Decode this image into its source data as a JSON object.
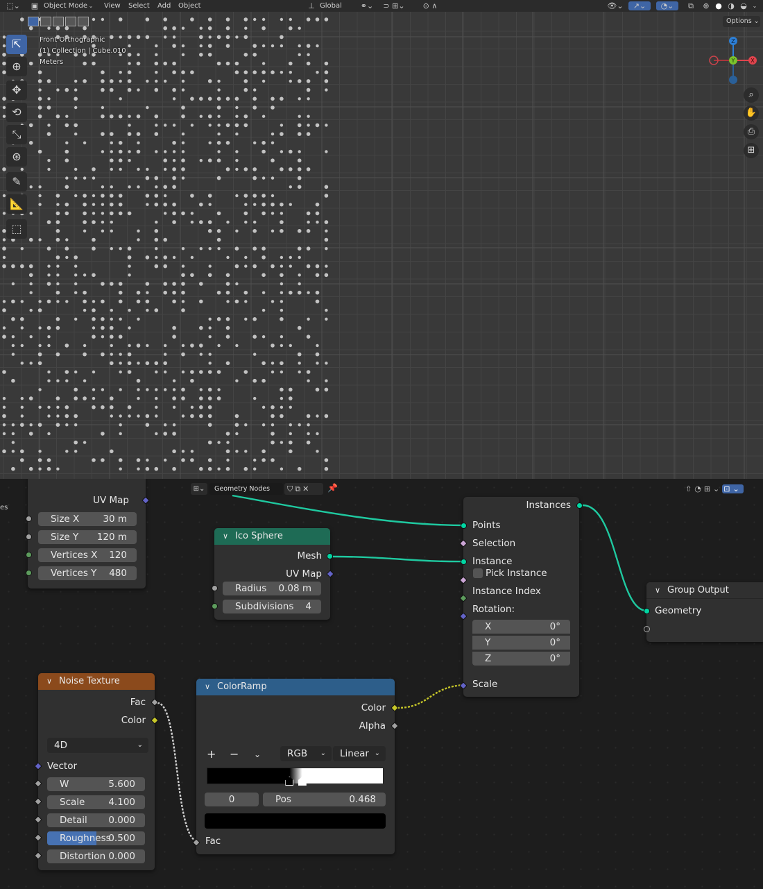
{
  "viewport_header": {
    "mode": "Object Mode",
    "menu": [
      "View",
      "Select",
      "Add",
      "Object"
    ],
    "orientation": "Global",
    "options_label": "Options"
  },
  "viewport_overlay": {
    "view_name": "Front Orthographic",
    "collection": "(1) Collection | Cube.010",
    "units": "Meters"
  },
  "gizmo": {
    "z": "Z",
    "y": "Y",
    "x": "X"
  },
  "node_editor": {
    "tree_name": "Geometry Nodes",
    "left_cut_text": "es"
  },
  "grid_node": {
    "output_uvmap": "UV Map",
    "fields": [
      {
        "label": "Size X",
        "value": "30 m"
      },
      {
        "label": "Size Y",
        "value": "120 m"
      },
      {
        "label": "Vertices X",
        "value": "120"
      },
      {
        "label": "Vertices Y",
        "value": "480"
      }
    ]
  },
  "ico_sphere": {
    "title": "Ico Sphere",
    "out_mesh": "Mesh",
    "out_uvmap": "UV Map",
    "radius_label": "Radius",
    "radius_value": "0.08 m",
    "subdiv_label": "Subdivisions",
    "subdiv_value": "4"
  },
  "instance_node": {
    "out_instances": "Instances",
    "in_points": "Points",
    "in_selection": "Selection",
    "in_instance": "Instance",
    "pick_instance": "Pick Instance",
    "instance_index": "Instance Index",
    "rotation": "Rotation:",
    "rot": [
      {
        "label": "X",
        "value": "0°"
      },
      {
        "label": "Y",
        "value": "0°"
      },
      {
        "label": "Z",
        "value": "0°"
      }
    ],
    "scale": "Scale"
  },
  "group_output": {
    "title": "Group Output",
    "geometry": "Geometry"
  },
  "noise_texture": {
    "title": "Noise Texture",
    "out_fac": "Fac",
    "out_color": "Color",
    "dimension": "4D",
    "in_vector": "Vector",
    "fields": [
      {
        "label": "W",
        "value": "5.600"
      },
      {
        "label": "Scale",
        "value": "4.100"
      },
      {
        "label": "Detail",
        "value": "0.000"
      },
      {
        "label": "Roughness",
        "value": "0.500",
        "fill": 0.5
      },
      {
        "label": "Distortion",
        "value": "0.000"
      }
    ]
  },
  "color_ramp": {
    "title": "ColorRamp",
    "out_color": "Color",
    "out_alpha": "Alpha",
    "mode": "RGB",
    "interpolation": "Linear",
    "add": "+",
    "remove": "−",
    "stop_index": "0",
    "pos_label": "Pos",
    "pos_value": "0.468",
    "in_fac": "Fac",
    "stops": [
      0.468,
      0.54
    ]
  },
  "colors": {
    "geometry_link": "#1fc9a0",
    "noise_header": "#8b4a1c",
    "ico_header": "#1e6b55",
    "ramp_header": "#2d5e8a",
    "active_tool": "#3f65a5"
  }
}
